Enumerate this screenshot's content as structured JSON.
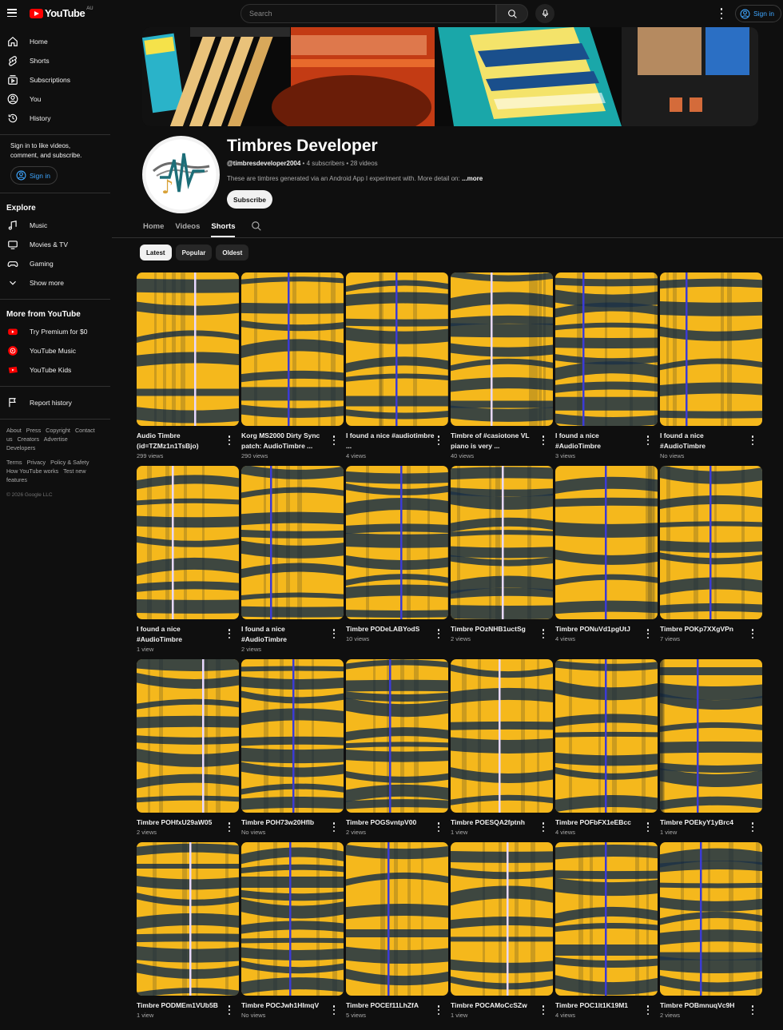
{
  "topbar": {
    "logo_text": "YouTube",
    "logo_country": "AU",
    "search_placeholder": "Search",
    "signin_label": "Sign in"
  },
  "sidebar": {
    "main": [
      {
        "label": "Home",
        "icon": "home-icon"
      },
      {
        "label": "Shorts",
        "icon": "shorts-icon"
      },
      {
        "label": "Subscriptions",
        "icon": "subscriptions-icon"
      },
      {
        "label": "You",
        "icon": "you-icon"
      },
      {
        "label": "History",
        "icon": "history-icon"
      }
    ],
    "signin_note": "Sign in to like videos, comment, and subscribe.",
    "signin_label": "Sign in",
    "explore_heading": "Explore",
    "explore": [
      {
        "label": "Music",
        "icon": "music-icon"
      },
      {
        "label": "Movies & TV",
        "icon": "movies-icon"
      },
      {
        "label": "Gaming",
        "icon": "gaming-icon"
      },
      {
        "label": "Show more",
        "icon": "chevron-down-icon"
      }
    ],
    "more_heading": "More from YouTube",
    "more": [
      {
        "label": "Try Premium for $0",
        "icon": "youtube-premium-icon"
      },
      {
        "label": "YouTube Music",
        "icon": "youtube-music-icon"
      },
      {
        "label": "YouTube Kids",
        "icon": "youtube-kids-icon"
      }
    ],
    "report_history": "Report history",
    "footer_links_1": [
      "About",
      "Press",
      "Copyright",
      "Contact us",
      "Creators",
      "Advertise",
      "Developers"
    ],
    "footer_links_2": [
      "Terms",
      "Privacy",
      "Policy & Safety",
      "How YouTube works",
      "Test new features"
    ],
    "copyright": "© 2026 Google LLC"
  },
  "channel": {
    "name": "Timbres Developer",
    "handle": "@timbresdeveloper2004",
    "subscribers": "4 subscribers",
    "videos": "28 videos",
    "description": "These are timbres generated via an Android App I experiment with. More detail on: ",
    "more_label": "...more",
    "subscribe_label": "Subscribe"
  },
  "tabs": [
    {
      "label": "Home",
      "active": false
    },
    {
      "label": "Videos",
      "active": false
    },
    {
      "label": "Shorts",
      "active": true
    }
  ],
  "chips": [
    {
      "label": "Latest",
      "active": true
    },
    {
      "label": "Popular",
      "active": false
    },
    {
      "label": "Oldest",
      "active": false
    }
  ],
  "colors": {
    "background": "#0f0f0f",
    "link": "#3ea6ff",
    "brand_red": "#ff0000",
    "thumb_gold": "#f5b81c",
    "thumb_navy": "#1d3247"
  },
  "shorts": [
    {
      "title": "Audio Timbre (id=TZMz1n1TsBjo)",
      "views": "299 views"
    },
    {
      "title": "Korg MS2000 Dirty Sync patch: AudioTimbre ...",
      "views": "290 views"
    },
    {
      "title": "I found a nice #audiotimbre ...",
      "views": "4 views"
    },
    {
      "title": "Timbre of #casiotone VL piano is very ...",
      "views": "40 views"
    },
    {
      "title": "I found a nice #AudioTimbre",
      "views": "3 views"
    },
    {
      "title": "I found a nice #AudioTimbre",
      "views": "No views"
    },
    {
      "title": "I found a nice #AudioTimbre",
      "views": "1 view"
    },
    {
      "title": "I found a nice #AudioTimbre",
      "views": "2 views"
    },
    {
      "title": "Timbre PODeLABYodS",
      "views": "10 views"
    },
    {
      "title": "Timbre POzNHB1uctSg",
      "views": "2 views"
    },
    {
      "title": "Timbre PONuVd1pgUtJ",
      "views": "4 views"
    },
    {
      "title": "Timbre POKp7XXgVPn",
      "views": "7 views"
    },
    {
      "title": "Timbre POHfxU29aW05",
      "views": "2 views"
    },
    {
      "title": "Timbre POH73w20Hflb",
      "views": "No views"
    },
    {
      "title": "Timbre POGSvntpV00",
      "views": "2 views"
    },
    {
      "title": "Timbre POESQA2fptnh",
      "views": "1 view"
    },
    {
      "title": "Timbre POFbFX1eEBcc",
      "views": "4 views"
    },
    {
      "title": "Timbre POEkyY1yBrc4",
      "views": "1 view"
    },
    {
      "title": "Timbre PODMEm1VUb5B",
      "views": "1 view"
    },
    {
      "title": "Timbre POCJwh1HImqV",
      "views": "No views"
    },
    {
      "title": "Timbre POCEf11LhZfA",
      "views": "5 views"
    },
    {
      "title": "Timbre POCAMoCcSZw",
      "views": "1 view"
    },
    {
      "title": "Timbre POC1lt1K19M1",
      "views": "4 views"
    },
    {
      "title": "Timbre POBmnuqVc9H",
      "views": "2 views"
    }
  ]
}
